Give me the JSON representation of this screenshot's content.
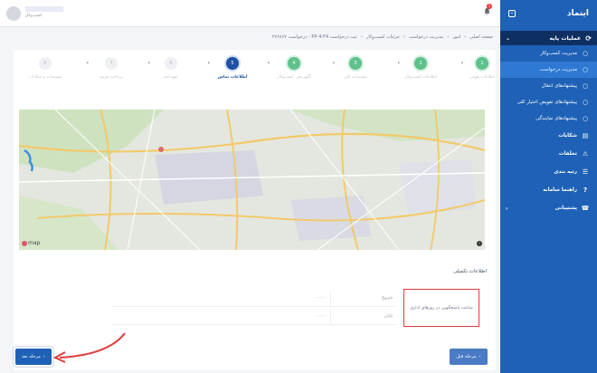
{
  "sidebar": {
    "logo": "اینماد",
    "section": "عملیات پایه",
    "items": [
      {
        "label": "مدیریت کسب‌وکار",
        "icon": "dot-icon"
      },
      {
        "label": "مدیریت درخواست",
        "icon": "dot-icon"
      },
      {
        "label": "پیشنهادهای انتقال",
        "icon": "dot-icon"
      },
      {
        "label": "پیشنهادهای تفویض اختیار کلی",
        "icon": "dot-icon"
      },
      {
        "label": "پیشنهادهای نمایندگی",
        "icon": "dot-icon"
      }
    ],
    "top_items": [
      {
        "label": "شکایات",
        "icon": "document-icon"
      },
      {
        "label": "تخلفات",
        "icon": "warning-icon"
      },
      {
        "label": "رتبه بندی",
        "icon": "ranking-icon"
      },
      {
        "label": "راهنما سامانه",
        "icon": "help-icon"
      },
      {
        "label": "پشتیبانی",
        "icon": "support-icon"
      }
    ]
  },
  "topbar": {
    "user_role": "کسب‌وکار",
    "notification_count": "1"
  },
  "breadcrumb": [
    "صفحه اصلی",
    "امور",
    "مدیریت درخواست",
    "جزئیات کسب‌وکار",
    "ثبت درخواست PP-4-F4 - درخواست ۲۷۶۸۶۷"
  ],
  "steps": [
    {
      "label": "اطلاعات هویتی",
      "state": "done",
      "num": "1"
    },
    {
      "label": "اطلاعات کسب‌وکار",
      "state": "done",
      "num": "2"
    },
    {
      "label": "مستندات کلی",
      "state": "done",
      "num": "3"
    },
    {
      "label": "آگهی‌دهی کسب‌وکار",
      "state": "done",
      "num": "4"
    },
    {
      "label": "اطلاعات تماس",
      "state": "current",
      "num": "5"
    },
    {
      "label": "تعهدنامه",
      "state": "pending",
      "num": "6"
    },
    {
      "label": "پرداخت هزینه",
      "state": "pending",
      "num": "7"
    },
    {
      "label": "مستندات و شکایات",
      "state": "pending",
      "num": "8"
    }
  ],
  "map": {
    "brand": "map",
    "info": "i"
  },
  "location": {
    "title": "اطلاعات تکمیلی",
    "box_label": "ساعت پاسخگویی در روزهای اداری",
    "start_label": "شروع",
    "end_label": "پایان",
    "start_value": "۰۰:۰۰",
    "end_value": "۰۰:۰۰"
  },
  "buttons": {
    "next": "مرحله بعد",
    "prev": "مرحله قبل",
    "next_arrow": "›",
    "prev_arrow": "‹"
  },
  "colors": {
    "sidebar": "#1e61b6",
    "sidebar_section": "#0f2f63",
    "active_item": "#2f79d4",
    "step_done": "#5ec28a",
    "step_current": "#1e4fa3",
    "annotation": "#e03b3b"
  }
}
